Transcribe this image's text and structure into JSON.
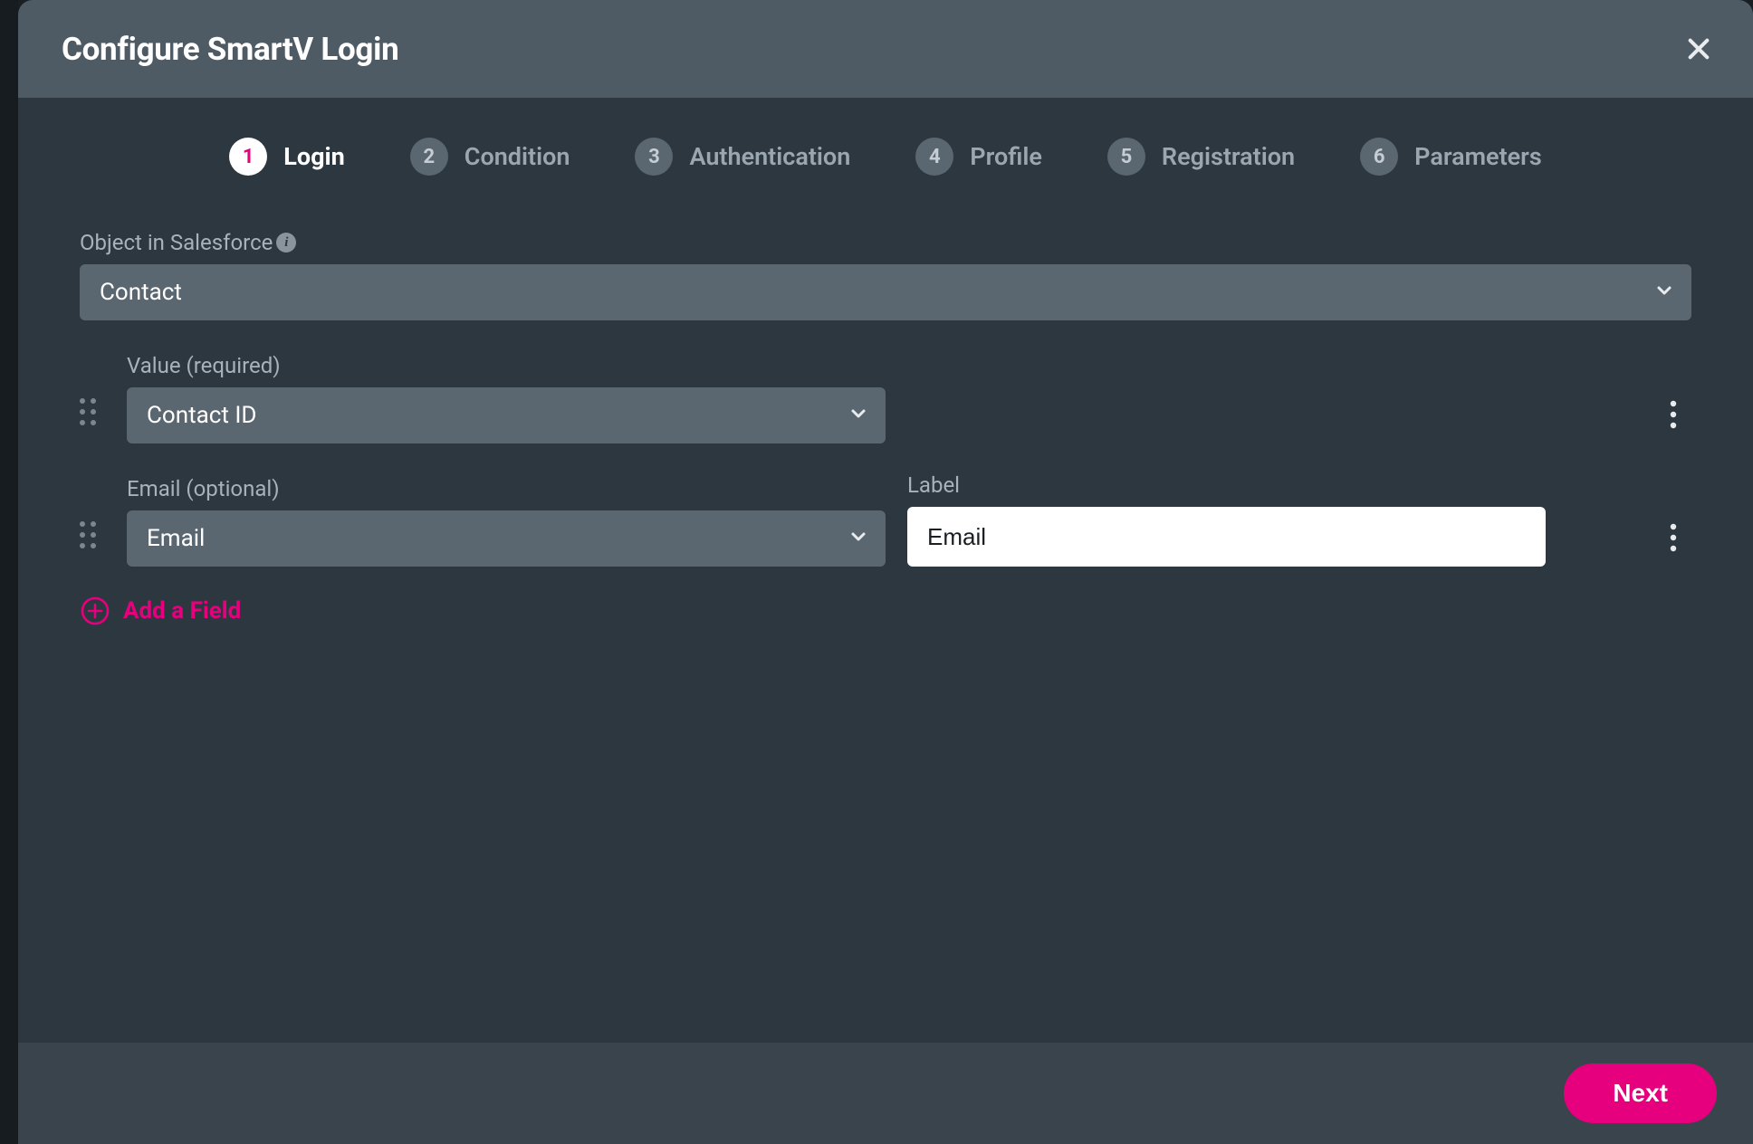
{
  "modal": {
    "title": "Configure SmartV Login"
  },
  "steps": [
    {
      "num": "1",
      "label": "Login",
      "active": true
    },
    {
      "num": "2",
      "label": "Condition",
      "active": false
    },
    {
      "num": "3",
      "label": "Authentication",
      "active": false
    },
    {
      "num": "4",
      "label": "Profile",
      "active": false
    },
    {
      "num": "5",
      "label": "Registration",
      "active": false
    },
    {
      "num": "6",
      "label": "Parameters",
      "active": false
    }
  ],
  "object_field": {
    "label": "Object in Salesforce",
    "value": "Contact"
  },
  "rows": [
    {
      "select_label": "Value (required)",
      "select_value": "Contact ID",
      "has_text": false,
      "text_label": "",
      "text_value": ""
    },
    {
      "select_label": "Email (optional)",
      "select_value": "Email",
      "has_text": true,
      "text_label": "Label",
      "text_value": "Email"
    }
  ],
  "add_field_label": "Add a Field",
  "footer": {
    "next": "Next"
  },
  "icons": {
    "close": "close-icon",
    "info": "info-icon",
    "chevron_down": "chevron-down-icon",
    "drag": "drag-handle-icon",
    "kebab": "kebab-menu-icon",
    "plus_circle": "plus-circle-icon"
  },
  "colors": {
    "accent": "#e6007e",
    "modal_bg": "#2c3740",
    "header_bg": "#4e5a64",
    "input_bg": "#5b6770",
    "footer_bg": "#3a444d"
  }
}
